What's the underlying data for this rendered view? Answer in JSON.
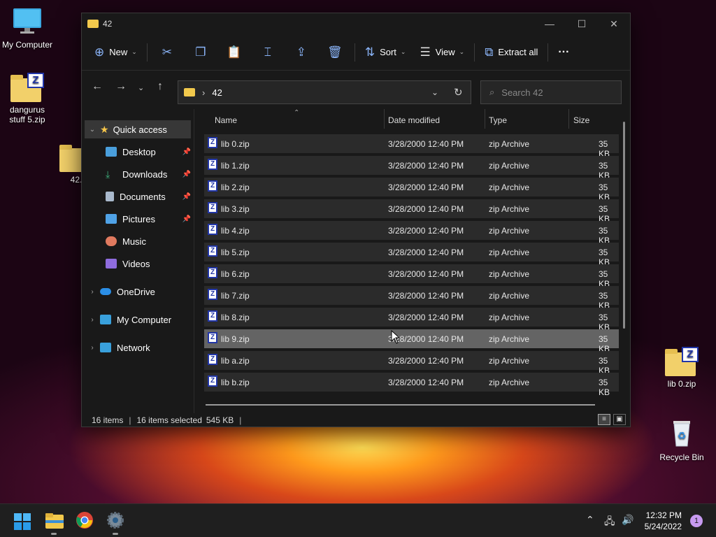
{
  "desktop": {
    "icons": [
      {
        "label": "My Computer"
      },
      {
        "label": "dangurus stuff 5.zip"
      },
      {
        "label": "42."
      },
      {
        "label": "lib 0.zip"
      },
      {
        "label": "Recycle Bin"
      }
    ]
  },
  "window": {
    "title": "42",
    "controls": {
      "minimize": "—",
      "maximize": "☐",
      "close": "✕"
    }
  },
  "toolbar": {
    "new_label": "New",
    "sort_label": "Sort",
    "view_label": "View",
    "extract_label": "Extract all",
    "more_label": "···"
  },
  "address": {
    "path": "42",
    "separator": "›",
    "search_placeholder": "Search 42"
  },
  "nav_pane": {
    "items": [
      {
        "label": "Quick access",
        "icon": "star-icon",
        "color": "#f7c64a"
      },
      {
        "label": "Desktop",
        "icon": "desktop-folder-icon",
        "color": "#4a9fdc",
        "pinned": true
      },
      {
        "label": "Downloads",
        "icon": "download-icon",
        "color": "#3fb37f",
        "pinned": true
      },
      {
        "label": "Documents",
        "icon": "documents-icon",
        "color": "#a9b9cc",
        "pinned": true
      },
      {
        "label": "Pictures",
        "icon": "pictures-icon",
        "color": "#4fa2e6",
        "pinned": true
      },
      {
        "label": "Music",
        "icon": "music-icon",
        "color": "#e07a5f"
      },
      {
        "label": "Videos",
        "icon": "videos-icon",
        "color": "#8f6cde"
      },
      {
        "label": "OneDrive",
        "icon": "cloud-icon",
        "color": "#2b8ee6"
      },
      {
        "label": "My Computer",
        "icon": "computer-icon",
        "color": "#39a0dc"
      },
      {
        "label": "Network",
        "icon": "network-icon",
        "color": "#39a0dc"
      }
    ]
  },
  "file_list": {
    "columns": {
      "name": "Name",
      "date": "Date modified",
      "type": "Type",
      "size": "Size"
    },
    "rows": [
      {
        "name": "lib 0.zip",
        "date": "3/28/2000 12:40 PM",
        "type": "zip Archive",
        "size": "35 KB"
      },
      {
        "name": "lib 1.zip",
        "date": "3/28/2000 12:40 PM",
        "type": "zip Archive",
        "size": "35 KB"
      },
      {
        "name": "lib 2.zip",
        "date": "3/28/2000 12:40 PM",
        "type": "zip Archive",
        "size": "35 KB"
      },
      {
        "name": "lib 3.zip",
        "date": "3/28/2000 12:40 PM",
        "type": "zip Archive",
        "size": "35 KB"
      },
      {
        "name": "lib 4.zip",
        "date": "3/28/2000 12:40 PM",
        "type": "zip Archive",
        "size": "35 KB"
      },
      {
        "name": "lib 5.zip",
        "date": "3/28/2000 12:40 PM",
        "type": "zip Archive",
        "size": "35 KB"
      },
      {
        "name": "lib 6.zip",
        "date": "3/28/2000 12:40 PM",
        "type": "zip Archive",
        "size": "35 KB"
      },
      {
        "name": "lib 7.zip",
        "date": "3/28/2000 12:40 PM",
        "type": "zip Archive",
        "size": "35 KB"
      },
      {
        "name": "lib 8.zip",
        "date": "3/28/2000 12:40 PM",
        "type": "zip Archive",
        "size": "35 KB"
      },
      {
        "name": "lib 9.zip",
        "date": "3/28/2000 12:40 PM",
        "type": "zip Archive",
        "size": "35 KB"
      },
      {
        "name": "lib a.zip",
        "date": "3/28/2000 12:40 PM",
        "type": "zip Archive",
        "size": "35 KB"
      },
      {
        "name": "lib b.zip",
        "date": "3/28/2000 12:40 PM",
        "type": "zip Archive",
        "size": "35 KB"
      }
    ]
  },
  "status": {
    "items": "16 items",
    "selected": "16 items selected",
    "size": "545 KB"
  },
  "taskbar": {
    "time": "12:32 PM",
    "date": "5/24/2022",
    "notifications": "1"
  }
}
